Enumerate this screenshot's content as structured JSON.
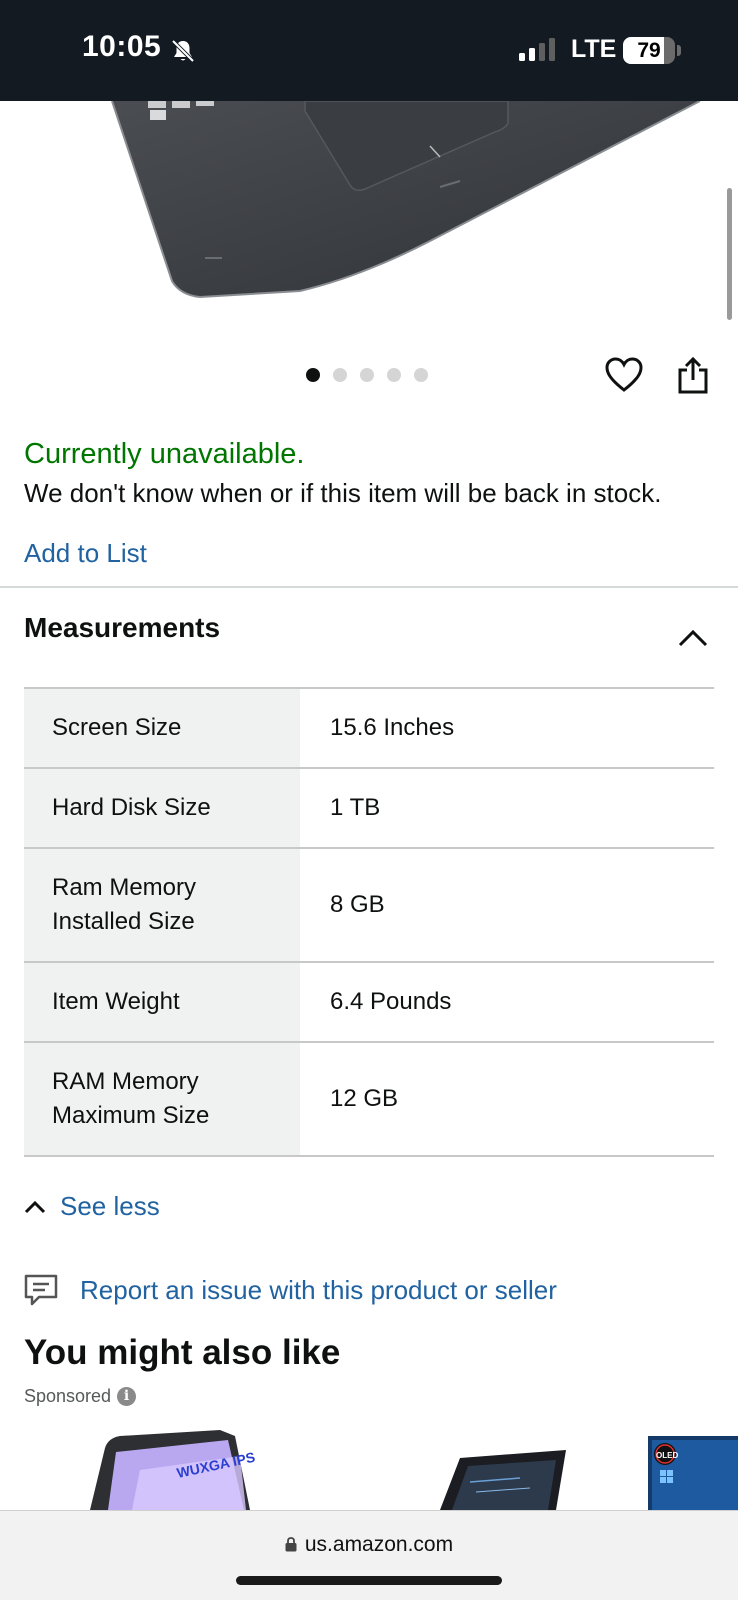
{
  "status_bar": {
    "time": "10:05",
    "network": "LTE",
    "battery": "79",
    "battery_level": 0.79
  },
  "carousel": {
    "image_count": 5,
    "active_index": 0
  },
  "availability": {
    "status": "Currently unavailable.",
    "message": "We don't know when or if this item will be back in stock.",
    "add_to_list": "Add to List"
  },
  "measurements": {
    "title": "Measurements",
    "rows": [
      {
        "key": "Screen Size",
        "value": "15.6 Inches"
      },
      {
        "key": "Hard Disk Size",
        "value": "1 TB"
      },
      {
        "key": "Ram Memory Installed Size",
        "value": "8 GB"
      },
      {
        "key": "Item Weight",
        "value": "6.4 Pounds"
      },
      {
        "key": "RAM Memory Maximum Size",
        "value": "12 GB"
      }
    ],
    "see_less": "See less"
  },
  "report": {
    "label": "Report an issue with this product or seller"
  },
  "recommendations": {
    "title": "You might also like",
    "sponsored": "Sponsored",
    "info": "i",
    "item1_badge": "WUXGA IPS",
    "item3_badge": "OLED"
  },
  "browser": {
    "url": "us.amazon.com"
  },
  "colors": {
    "available_green": "#007600",
    "link_blue": "#2162a1",
    "status_bar_bg": "#131a22"
  }
}
